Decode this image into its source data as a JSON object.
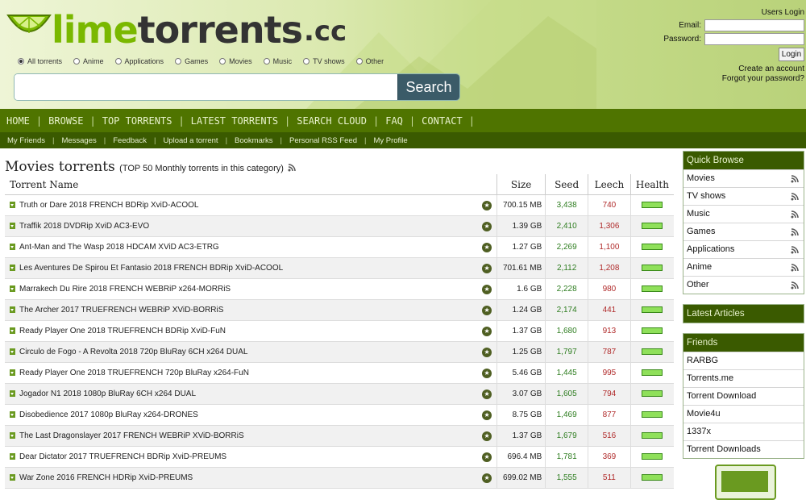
{
  "logo": {
    "part1": "lime",
    "part2": "torrents",
    "part3": ".cc"
  },
  "search": {
    "categories": [
      {
        "label": "All torrents",
        "selected": true
      },
      {
        "label": "Anime",
        "selected": false
      },
      {
        "label": "Applications",
        "selected": false
      },
      {
        "label": "Games",
        "selected": false
      },
      {
        "label": "Movies",
        "selected": false
      },
      {
        "label": "Music",
        "selected": false
      },
      {
        "label": "TV shows",
        "selected": false
      },
      {
        "label": "Other",
        "selected": false
      }
    ],
    "value": "",
    "button_label": "Search"
  },
  "login": {
    "title": "Users Login",
    "email_label": "Email:",
    "password_label": "Password:",
    "button_label": "Login",
    "create_account": "Create an account",
    "forgot_password": "Forgot your password?"
  },
  "nav": [
    "HOME",
    "BROWSE",
    "TOP TORRENTS",
    "LATEST TORRENTS",
    "SEARCH CLOUD",
    "FAQ",
    "CONTACT"
  ],
  "subnav": [
    "My Friends",
    "Messages",
    "Feedback",
    "Upload a torrent",
    "Bookmarks",
    "Personal RSS Feed",
    "My Profile"
  ],
  "main": {
    "title": "Movies torrents",
    "subtitle": "(TOP 50 Monthly torrents in this category)",
    "columns": {
      "name": "Torrent Name",
      "size": "Size",
      "seed": "Seed",
      "leech": "Leech",
      "health": "Health"
    },
    "rows": [
      {
        "name": "Truth or Dare 2018 FRENCH BDRip XviD-ACOOL",
        "size": "700.15 MB",
        "seed": "3,438",
        "leech": "740"
      },
      {
        "name": "Traffik 2018 DVDRip XviD AC3-EVO",
        "size": "1.39 GB",
        "seed": "2,410",
        "leech": "1,306"
      },
      {
        "name": "Ant-Man and The Wasp 2018 HDCAM XViD AC3-ETRG",
        "size": "1.27 GB",
        "seed": "2,269",
        "leech": "1,100"
      },
      {
        "name": "Les Aventures De Spirou Et Fantasio 2018 FRENCH BDRip XviD-ACOOL",
        "size": "701.61 MB",
        "seed": "2,112",
        "leech": "1,208"
      },
      {
        "name": "Marrakech Du Rire 2018 FRENCH WEBRiP x264-MORRiS",
        "size": "1.6 GB",
        "seed": "2,228",
        "leech": "980"
      },
      {
        "name": "The Archer 2017 TRUEFRENCH WEBRiP XViD-BORRiS",
        "size": "1.24 GB",
        "seed": "2,174",
        "leech": "441"
      },
      {
        "name": "Ready Player One 2018 TRUEFRENCH BDRip XviD-FuN",
        "size": "1.37 GB",
        "seed": "1,680",
        "leech": "913"
      },
      {
        "name": "Circulo de Fogo - A Revolta 2018 720p BluRay 6CH x264 DUAL",
        "size": "1.25 GB",
        "seed": "1,797",
        "leech": "787"
      },
      {
        "name": "Ready Player One 2018 TRUEFRENCH 720p BluRay x264-FuN",
        "size": "5.46 GB",
        "seed": "1,445",
        "leech": "995"
      },
      {
        "name": "Jogador N1 2018 1080p BluRay 6CH x264 DUAL",
        "size": "3.07 GB",
        "seed": "1,605",
        "leech": "794"
      },
      {
        "name": "Disobedience 2017 1080p BluRay x264-DRONES",
        "size": "8.75 GB",
        "seed": "1,469",
        "leech": "877"
      },
      {
        "name": "The Last Dragonslayer 2017 FRENCH WEBRiP XViD-BORRiS",
        "size": "1.37 GB",
        "seed": "1,679",
        "leech": "516"
      },
      {
        "name": "Dear Dictator 2017 TRUEFRENCH BDRip XviD-PREUMS",
        "size": "696.4 MB",
        "seed": "1,781",
        "leech": "369"
      },
      {
        "name": "War Zone 2016 FRENCH HDRip XviD-PREUMS",
        "size": "699.02 MB",
        "seed": "1,555",
        "leech": "511"
      }
    ]
  },
  "sidebar": {
    "quick_browse_title": "Quick Browse",
    "quick_browse": [
      "Movies",
      "TV shows",
      "Music",
      "Games",
      "Applications",
      "Anime",
      "Other"
    ],
    "latest_articles_title": "Latest Articles",
    "friends_title": "Friends",
    "friends": [
      "RARBG",
      "Torrents.me",
      "Torrent Download",
      "Movie4u",
      "1337x",
      "Torrent Downloads"
    ]
  },
  "colors": {
    "brand_green": "#4f7400",
    "dark_green": "#3a5a00",
    "seed": "#2e7d20",
    "leech": "#b02a2a"
  }
}
